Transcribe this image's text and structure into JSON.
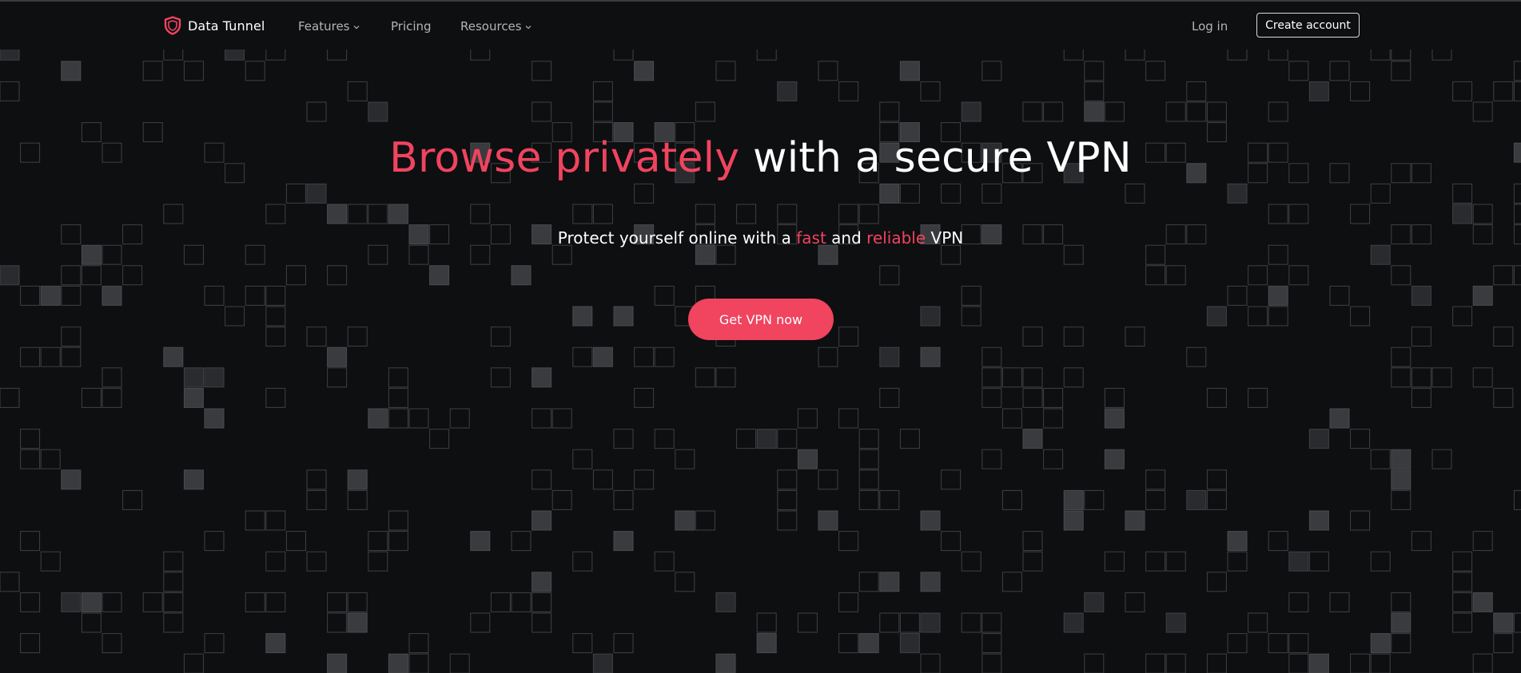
{
  "brand": {
    "name": "Data Tunnel",
    "icon": "shield-icon",
    "accent_color": "#f0445f"
  },
  "nav": {
    "features": "Features",
    "pricing": "Pricing",
    "resources": "Resources",
    "login": "Log in",
    "create_account": "Create account"
  },
  "hero": {
    "title_accent": "Browse privately",
    "title_rest": " with a secure VPN",
    "subtitle_pre": "Protect yourself online with a ",
    "subtitle_fast": "fast",
    "subtitle_mid": " and ",
    "subtitle_reliable": "reliable",
    "subtitle_post": " VPN",
    "cta": "Get VPN now"
  },
  "colors": {
    "background": "#0e0f11",
    "accent": "#f0445f",
    "text": "#ffffff",
    "muted_text": "#b3b4b8"
  }
}
